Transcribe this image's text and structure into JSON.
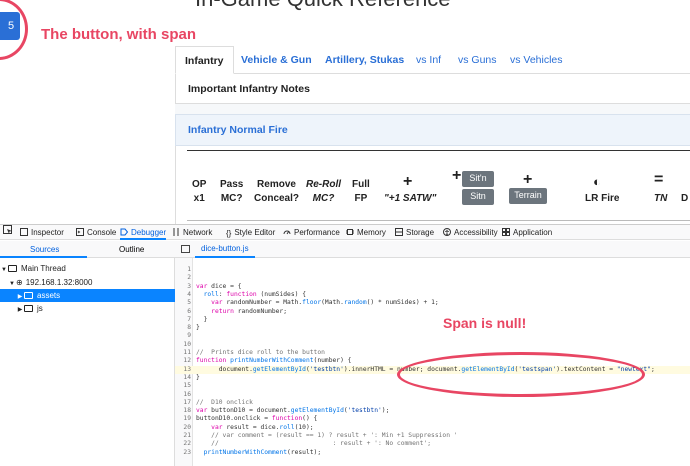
{
  "page": {
    "title": "In-Game Quick Reference",
    "dice_button_label": "5",
    "tabs": [
      {
        "label": "Infantry"
      },
      {
        "label": "Vehicle & Gun"
      },
      {
        "label": "Artillery, Stukas"
      },
      {
        "label": "vs Inf"
      },
      {
        "label": "vs Guns"
      },
      {
        "label": "vs Vehicles"
      }
    ],
    "notes_heading": "Important Infantry Notes",
    "fire_heading": "Infantry Normal Fire",
    "columns": {
      "op": [
        "OP",
        "x1"
      ],
      "pass": [
        "Pass",
        "MC?"
      ],
      "remove": [
        "Remove",
        "Conceal?"
      ],
      "reroll": [
        "Re-Roll",
        "MC?"
      ],
      "full": [
        "Full",
        "FP"
      ],
      "satw_plus": "+",
      "satw": "\"+1 SATW\"",
      "sitn_plus": "+",
      "sitn_chip_top": "Sit'n",
      "sitn_chip_bottom": "Sitn",
      "terrain_plus": "+",
      "terrain_chip": "Terrain",
      "lr_icon": "◐",
      "lr_fire": "LR Fire",
      "tn_eq": "=",
      "tn": "TN",
      "d": "D"
    }
  },
  "annotations": {
    "button_note": "The button, with span",
    "null_note": "Span is null!"
  },
  "devtools": {
    "toolbar": [
      {
        "label": "Inspector",
        "icon": "inspector-icon"
      },
      {
        "label": "Console",
        "icon": "console-icon"
      },
      {
        "label": "Debugger",
        "icon": "debugger-icon"
      },
      {
        "label": "Network",
        "icon": "network-icon"
      },
      {
        "label": "Style Editor",
        "icon": "style-editor-icon"
      },
      {
        "label": "Performance",
        "icon": "performance-icon"
      },
      {
        "label": "Memory",
        "icon": "memory-icon"
      },
      {
        "label": "Storage",
        "icon": "storage-icon"
      },
      {
        "label": "Accessibility",
        "icon": "accessibility-icon"
      },
      {
        "label": "Application",
        "icon": "application-icon"
      }
    ],
    "sources_tab": "Sources",
    "outline_tab": "Outline",
    "tree": {
      "main_thread": "Main Thread",
      "host": "192.168.1.32:8000",
      "assets": "assets",
      "js": "js"
    },
    "file_tab": "dice-button.js",
    "accent": "#0a84ff"
  },
  "code_lines": [
    {
      "n": "1",
      "t": ""
    },
    {
      "n": "2",
      "t": ""
    },
    {
      "n": "3",
      "t": "var dice = {"
    },
    {
      "n": "4",
      "t": "  roll: function (numSides) {"
    },
    {
      "n": "5",
      "t": "    var randomNumber = Math.floor(Math.random() * numSides) + 1;"
    },
    {
      "n": "6",
      "t": "    return randomNumber;"
    },
    {
      "n": "7",
      "t": "  }"
    },
    {
      "n": "8",
      "t": "}"
    },
    {
      "n": "9",
      "t": ""
    },
    {
      "n": "10",
      "t": ""
    },
    {
      "n": "11",
      "t": "//  Prints dice roll to the button"
    },
    {
      "n": "12",
      "t": "function printNumberWithComment(number) {"
    },
    {
      "n": "13",
      "t": "      document.getElementById('testbtn').innerHTML = number; document.getElementById('testspan').textContent = \"newtext\";"
    },
    {
      "n": "14",
      "t": "}"
    },
    {
      "n": "15",
      "t": ""
    },
    {
      "n": "16",
      "t": ""
    },
    {
      "n": "17",
      "t": "//  D10 onclick"
    },
    {
      "n": "18",
      "t": "var buttonD10 = document.getElementById('testbtn');"
    },
    {
      "n": "19",
      "t": "buttonD10.onclick = function() {"
    },
    {
      "n": "20",
      "t": "    var result = dice.roll(10);"
    },
    {
      "n": "21",
      "t": "    // var comment = (result == 1) ? result + ': Min +1 Suppression '"
    },
    {
      "n": "22",
      "t": "    //                              : result + ': No comment';"
    },
    {
      "n": "23",
      "t": "  printNumberWithComment(result);"
    }
  ]
}
